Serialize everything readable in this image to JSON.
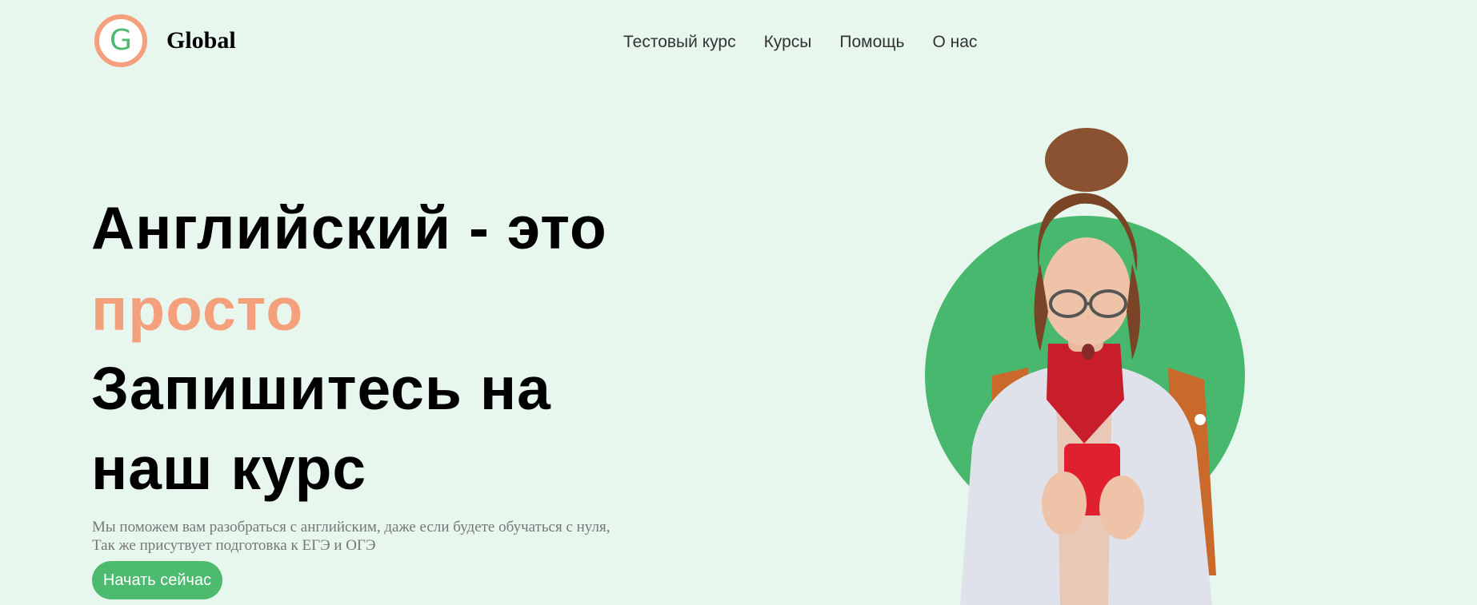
{
  "header": {
    "logo_letter": "G",
    "brand_name": "Global",
    "nav": [
      {
        "label": "Тестовый курс"
      },
      {
        "label": "Курсы"
      },
      {
        "label": "Помощь"
      },
      {
        "label": "О нас"
      }
    ]
  },
  "hero": {
    "line1": "Английский - это",
    "line2": "просто",
    "line3": "Запишитесь на",
    "line4": "наш курс",
    "sub1": "Мы поможем вам разобраться с английским, даже если будете обучаться с нуля,",
    "sub2": "Так же присутвует подготовка к ЕГЭ и ОГЭ",
    "cta_label": "Начать сейчас"
  },
  "colors": {
    "background": "#e7f7ed",
    "accent_green": "#4cba6f",
    "accent_peach": "#f5a07c"
  },
  "images": {
    "hero_photo": "woman-with-phone-illustration"
  }
}
